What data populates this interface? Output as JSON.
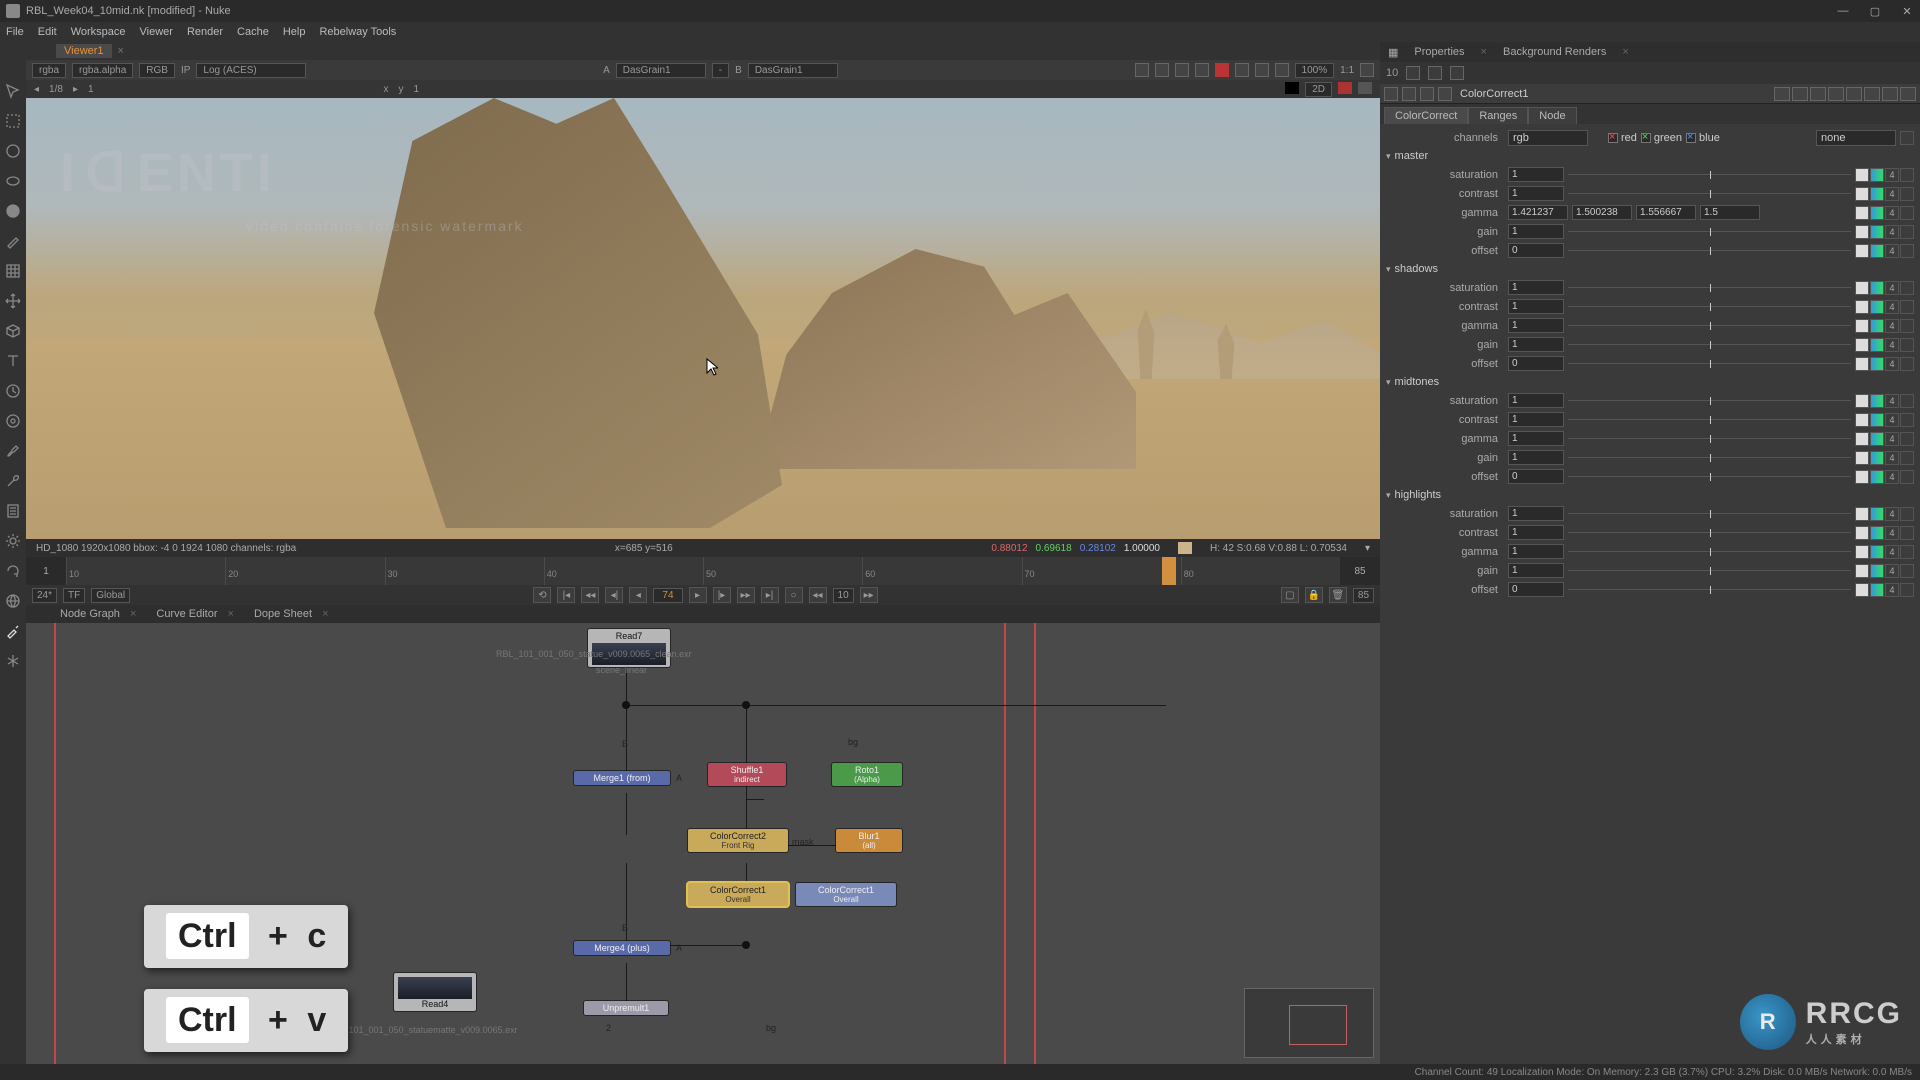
{
  "window": {
    "title": "RBL_Week04_10mid.nk [modified] - Nuke"
  },
  "menu": [
    "File",
    "Edit",
    "Workspace",
    "Viewer",
    "Render",
    "Cache",
    "Help",
    "Rebelway Tools"
  ],
  "viewer": {
    "tab": "Viewer1",
    "layer": "rgba",
    "alpha": "rgba.alpha",
    "channels": "RGB",
    "ip": "IP",
    "lut": "Log (ACES)",
    "inputA_lbl": "A",
    "inputA": "DasGrain1",
    "dash": "-",
    "inputB_lbl": "B",
    "inputB": "DasGrain1",
    "zoom": "100%",
    "ratio": "1:1",
    "nav": "1/8",
    "frame1": "1",
    "xlabel": "x",
    "ylabel": "y",
    "y1": "1",
    "mode2d": "2D"
  },
  "watermark": {
    "big": "ITИƎＤI",
    "line": "video contains forensic watermark"
  },
  "info": {
    "left": "HD_1080 1920x1080  bbox: -4 0 1924 1080 channels: rgba",
    "xy": "x=685 y=516",
    "r": "0.88012",
    "g": "0.69618",
    "b": "0.28102",
    "a": "1.00000",
    "hsv": "H: 42 S:0.68 V:0.88 L: 0.70534"
  },
  "timeline": {
    "start": "1",
    "end": "85",
    "ticks": [
      "10",
      "20",
      "30",
      "40",
      "50",
      "60",
      "70",
      "80"
    ],
    "current": "74"
  },
  "play": {
    "fps": "24*",
    "tf": "TF",
    "scope": "Global",
    "skip": "10",
    "endframe": "85"
  },
  "ngtabs": [
    "Node Graph",
    "Curve Editor",
    "Dope Sheet"
  ],
  "nodes": {
    "read7": {
      "name": "Read7",
      "path": "RBL_101_001_050_statue_v009.0065_clean.exr",
      "sub": "scene_linear"
    },
    "merge1": "Merge1 (from)",
    "shuffle1": {
      "name": "Shuffle1",
      "sub": "indirect"
    },
    "roto1": {
      "name": "Roto1",
      "sub": "(Alpha)"
    },
    "blur1": {
      "name": "Blur1",
      "sub": "(all)"
    },
    "cc2": {
      "name": "ColorCorrect2",
      "sub": "Front Rig"
    },
    "cc1": {
      "name": "ColorCorrect1",
      "sub": "Overall"
    },
    "cc1b": {
      "name": "ColorCorrect1",
      "sub": "Overall"
    },
    "merge2": "Merge4 (plus)",
    "unpre": "Unpremult1",
    "read4": {
      "name": "Read4",
      "path": "RBL_101_001_050_statuematte_v009.0065.exr"
    },
    "port_b1": "B",
    "port_a1": "A",
    "port_b2": "B",
    "port_a2": "A",
    "port_mask": "mask",
    "port_bg": "bg",
    "port_2": "2"
  },
  "shortcuts": {
    "mod": "Ctrl",
    "plus": "+",
    "c": "c",
    "v": "v"
  },
  "rp": {
    "tab_props": "Properties",
    "tab_bg": "Background Renders",
    "count": "10",
    "node": "ColorCorrect1",
    "tabs": [
      "ColorCorrect",
      "Ranges",
      "Node"
    ],
    "channels_lbl": "channels",
    "channels_val": "rgb",
    "red": "red",
    "green": "green",
    "blue": "blue",
    "mask_none": "none",
    "sections": {
      "master": "master",
      "shadows": "shadows",
      "midtones": "midtones",
      "highlights": "highlights"
    },
    "labels": {
      "sat": "saturation",
      "con": "contrast",
      "gam": "gamma",
      "gain": "gain",
      "off": "offset"
    },
    "one": "1",
    "zero": "0",
    "gamma": {
      "r": "1.421237",
      "g": "1.500238",
      "b": "1.556667",
      "a": "1.5"
    },
    "num4": "4"
  },
  "status": {
    "right": "Channel Count: 49 Localization Mode: On Memory: 2.3 GB (3.7%) CPU: 3.2% Disk: 0.0 MB/s Network: 0.0 MB/s"
  },
  "rrcg": {
    "logo": "R",
    "txt": "RRCG",
    "sub": "人人素材"
  }
}
